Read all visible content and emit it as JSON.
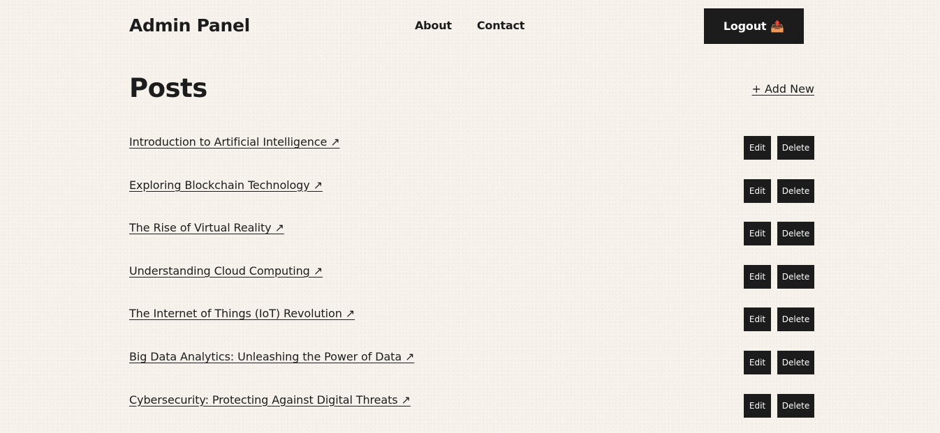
{
  "header": {
    "brand": "Admin Panel",
    "nav": [
      {
        "label": "About"
      },
      {
        "label": "Contact"
      }
    ],
    "logout_label": "Logout",
    "logout_icon": "📤"
  },
  "main": {
    "title": "Posts",
    "add_new_label": "+ Add New",
    "edit_label": "Edit",
    "delete_label": "Delete",
    "posts": [
      {
        "title": "Introduction to Artificial Intelligence ↗"
      },
      {
        "title": "Exploring Blockchain Technology ↗"
      },
      {
        "title": "The Rise of Virtual Reality ↗"
      },
      {
        "title": "Understanding Cloud Computing ↗"
      },
      {
        "title": "The Internet of Things (IoT) Revolution ↗"
      },
      {
        "title": "Big Data Analytics: Unleashing the Power of Data ↗"
      },
      {
        "title": "Cybersecurity: Protecting Against Digital Threats ↗"
      }
    ]
  }
}
